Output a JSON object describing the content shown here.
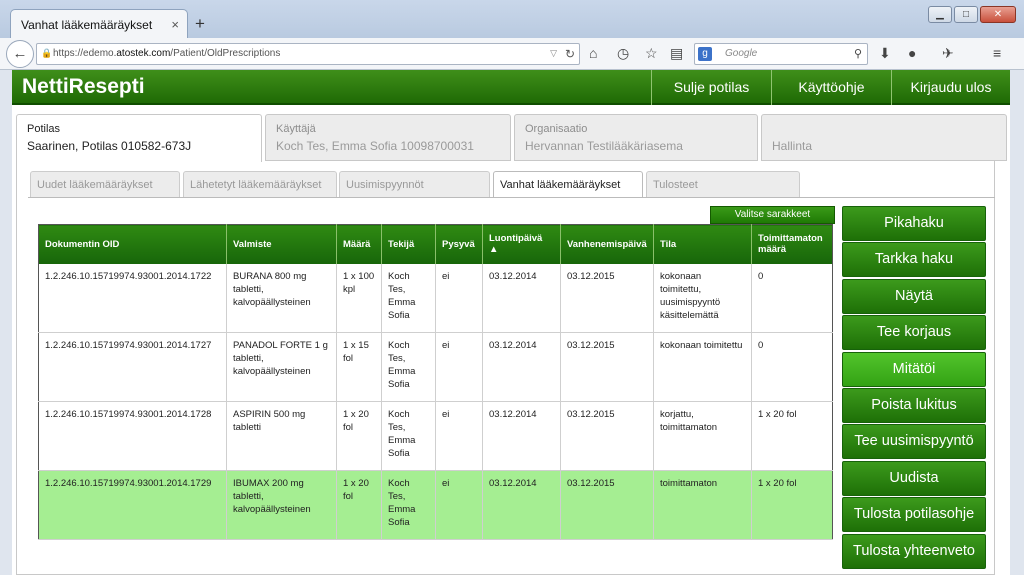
{
  "browser": {
    "tab_title": "Vanhat lääkemääräykset",
    "tab_close": "×",
    "new_tab": "+",
    "url_prefix": "https://edemo.",
    "url_host": "atostek.com",
    "url_path": "/Patient/OldPrescriptions",
    "search_placeholder": "Google",
    "search_engine_letter": "g"
  },
  "app": {
    "title": "NettiResepti",
    "header_buttons": [
      "Sulje potilas",
      "Käyttöohje",
      "Kirjaudu ulos"
    ]
  },
  "info_tabs": [
    {
      "label": "Potilas",
      "value": "Saarinen, Potilas 010582-673J"
    },
    {
      "label": "Käyttäjä",
      "value": "Koch Tes, Emma Sofia 10098700031"
    },
    {
      "label": "Organisaatio",
      "value": "Hervannan Testilääkäriasema"
    },
    {
      "label": "",
      "value": "Hallinta"
    }
  ],
  "sub_tabs": [
    "Uudet lääkemääräykset",
    "Lähetetyt lääkemääräykset",
    "Uusimispyynnöt",
    "Vanhat lääkemääräykset",
    "Tulosteet"
  ],
  "select_columns_label": "Valitse sarakkeet",
  "table": {
    "headers": [
      "Dokumentin OID",
      "Valmiste",
      "Määrä",
      "Tekijä",
      "Pysyvä",
      "Luontipäivä ▲",
      "Vanhenemispäivä",
      "Tila",
      "Toimittamaton määrä"
    ],
    "rows": [
      [
        "1.2.246.10.15719974.93001.2014.1722",
        "BURANA 800 mg tabletti, kalvopäällysteinen",
        "1 x 100 kpl",
        "Koch Tes, Emma Sofia",
        "ei",
        "03.12.2014",
        "03.12.2015",
        "kokonaan toimitettu, uusimispyyntö käsittelemättä",
        "0"
      ],
      [
        "1.2.246.10.15719974.93001.2014.1727",
        "PANADOL FORTE 1 g tabletti, kalvopäällysteinen",
        "1 x 15 fol",
        "Koch Tes, Emma Sofia",
        "ei",
        "03.12.2014",
        "03.12.2015",
        "kokonaan toimitettu",
        "0"
      ],
      [
        "1.2.246.10.15719974.93001.2014.1728",
        "ASPIRIN 500 mg tabletti",
        "1 x 20 fol",
        "Koch Tes, Emma Sofia",
        "ei",
        "03.12.2014",
        "03.12.2015",
        "korjattu, toimittamaton",
        "1 x 20 fol"
      ],
      [
        "1.2.246.10.15719974.93001.2014.1729",
        "IBUMAX 200 mg tabletti, kalvopäällysteinen",
        "1 x 20 fol",
        "Koch Tes, Emma Sofia",
        "ei",
        "03.12.2014",
        "03.12.2015",
        "toimittamaton",
        "1 x 20 fol"
      ]
    ]
  },
  "actions": [
    "Pikahaku",
    "Tarkka haku",
    "Näytä",
    "Tee korjaus",
    "Mitätöi",
    "Poista lukitus",
    "Tee uusimispyyntö",
    "Uudista",
    "Tulosta potilasohje",
    "Tulosta yhteenveto"
  ],
  "colors": {
    "brand_green": "#1f6a05",
    "selected_row": "#a5ee92",
    "highlight_button": "#52c42c"
  }
}
